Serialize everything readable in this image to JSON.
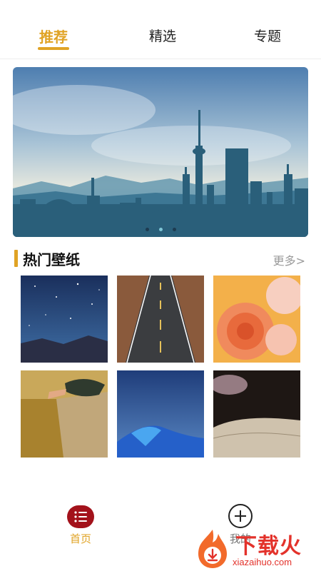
{
  "tabs": [
    {
      "label": "推荐",
      "active": true
    },
    {
      "label": "精选",
      "active": false
    },
    {
      "label": "专题",
      "active": false
    }
  ],
  "banner": {
    "slide_count": 3,
    "active_index": 1
  },
  "section": {
    "title": "热门壁纸",
    "more_label": "更多>"
  },
  "wallpapers": [
    {
      "subject": "starry-night-mountains"
    },
    {
      "subject": "desert-road"
    },
    {
      "subject": "peach-rose"
    },
    {
      "subject": "cliff-sitter"
    },
    {
      "subject": "blue-tent-night"
    },
    {
      "subject": "open-book"
    }
  ],
  "bottom_nav": {
    "home_label": "首页",
    "mine_label": "我的"
  },
  "watermark": {
    "text": "下载火",
    "sub": "xiazaihuo.com"
  },
  "colors": {
    "accent": "#e0a325",
    "home_icon": "#a3121b",
    "watermark": "#e3322b"
  }
}
